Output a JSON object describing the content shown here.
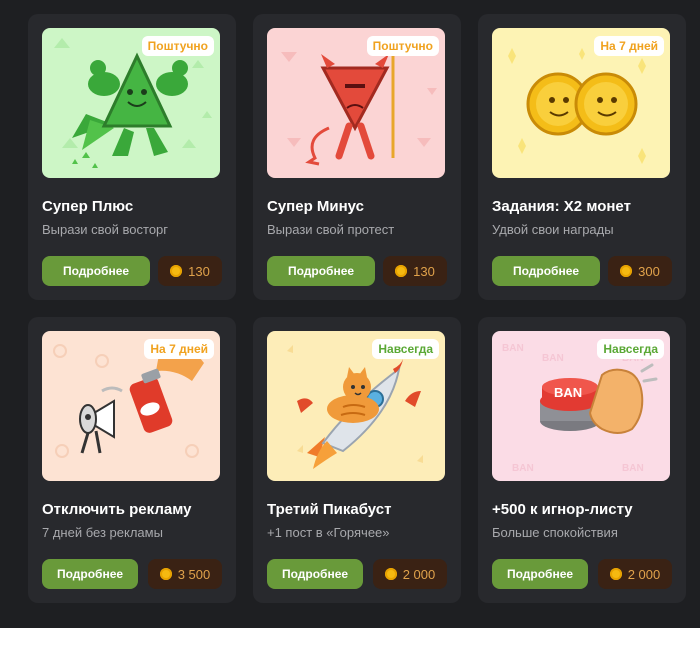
{
  "colors": {
    "background": "#1e1f22",
    "card": "#28292d",
    "button_green": "#699a3a",
    "price_bg": "#3a2214",
    "price_text": "#e0a24b",
    "badge_orange": "#f0a21f",
    "badge_green": "#5aa835"
  },
  "items": [
    {
      "title": "Супер Плюс",
      "subtitle": "Вырази свой восторг",
      "badge": "Поштучно",
      "button": "Подробнее",
      "price": "130",
      "icon": "muscular-plus-icon"
    },
    {
      "title": "Супер Минус",
      "subtitle": "Вырази свой протест",
      "badge": "Поштучно",
      "button": "Подробнее",
      "price": "130",
      "icon": "devil-minus-icon"
    },
    {
      "title": "Задания: X2 монет",
      "subtitle": "Удвой свои награды",
      "badge": "На 7 дней",
      "button": "Подробнее",
      "price": "300",
      "icon": "double-coin-icon"
    },
    {
      "title": "Отключить рекламу",
      "subtitle": "7 дней без рекламы",
      "badge": "На 7 дней",
      "button": "Подробнее",
      "price": "3 500",
      "icon": "ad-megaphone-spray-icon"
    },
    {
      "title": "Третий Пикабуст",
      "subtitle": "+1 пост в «Горячее»",
      "badge": "Навсегда",
      "button": "Подробнее",
      "price": "2 000",
      "icon": "cat-rocket-icon"
    },
    {
      "title": "+500 к игнор-листу",
      "subtitle": "Больше спокойствия",
      "badge": "Навсегда",
      "button": "Подробнее",
      "price": "2 000",
      "icon": "ban-button-icon"
    }
  ],
  "ban_text": "BAN"
}
